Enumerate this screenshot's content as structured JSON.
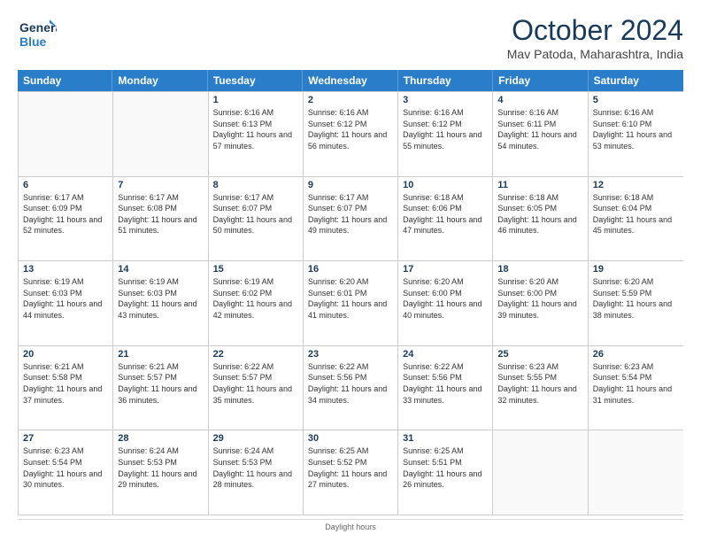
{
  "logo": {
    "line1": "General",
    "line2": "Blue"
  },
  "title": "October 2024",
  "location": "Mav Patoda, Maharashtra, India",
  "header_days": [
    "Sunday",
    "Monday",
    "Tuesday",
    "Wednesday",
    "Thursday",
    "Friday",
    "Saturday"
  ],
  "footer": "Daylight hours",
  "weeks": [
    [
      {
        "day": "",
        "sunrise": "",
        "sunset": "",
        "daylight": "",
        "empty": true
      },
      {
        "day": "",
        "sunrise": "",
        "sunset": "",
        "daylight": "",
        "empty": true
      },
      {
        "day": "1",
        "sunrise": "Sunrise: 6:16 AM",
        "sunset": "Sunset: 6:13 PM",
        "daylight": "Daylight: 11 hours and 57 minutes."
      },
      {
        "day": "2",
        "sunrise": "Sunrise: 6:16 AM",
        "sunset": "Sunset: 6:12 PM",
        "daylight": "Daylight: 11 hours and 56 minutes."
      },
      {
        "day": "3",
        "sunrise": "Sunrise: 6:16 AM",
        "sunset": "Sunset: 6:12 PM",
        "daylight": "Daylight: 11 hours and 55 minutes."
      },
      {
        "day": "4",
        "sunrise": "Sunrise: 6:16 AM",
        "sunset": "Sunset: 6:11 PM",
        "daylight": "Daylight: 11 hours and 54 minutes."
      },
      {
        "day": "5",
        "sunrise": "Sunrise: 6:16 AM",
        "sunset": "Sunset: 6:10 PM",
        "daylight": "Daylight: 11 hours and 53 minutes."
      }
    ],
    [
      {
        "day": "6",
        "sunrise": "Sunrise: 6:17 AM",
        "sunset": "Sunset: 6:09 PM",
        "daylight": "Daylight: 11 hours and 52 minutes.",
        "empty": false
      },
      {
        "day": "7",
        "sunrise": "Sunrise: 6:17 AM",
        "sunset": "Sunset: 6:08 PM",
        "daylight": "Daylight: 11 hours and 51 minutes.",
        "empty": false
      },
      {
        "day": "8",
        "sunrise": "Sunrise: 6:17 AM",
        "sunset": "Sunset: 6:07 PM",
        "daylight": "Daylight: 11 hours and 50 minutes.",
        "empty": false
      },
      {
        "day": "9",
        "sunrise": "Sunrise: 6:17 AM",
        "sunset": "Sunset: 6:07 PM",
        "daylight": "Daylight: 11 hours and 49 minutes.",
        "empty": false
      },
      {
        "day": "10",
        "sunrise": "Sunrise: 6:18 AM",
        "sunset": "Sunset: 6:06 PM",
        "daylight": "Daylight: 11 hours and 47 minutes.",
        "empty": false
      },
      {
        "day": "11",
        "sunrise": "Sunrise: 6:18 AM",
        "sunset": "Sunset: 6:05 PM",
        "daylight": "Daylight: 11 hours and 46 minutes.",
        "empty": false
      },
      {
        "day": "12",
        "sunrise": "Sunrise: 6:18 AM",
        "sunset": "Sunset: 6:04 PM",
        "daylight": "Daylight: 11 hours and 45 minutes.",
        "empty": false
      }
    ],
    [
      {
        "day": "13",
        "sunrise": "Sunrise: 6:19 AM",
        "sunset": "Sunset: 6:03 PM",
        "daylight": "Daylight: 11 hours and 44 minutes.",
        "empty": false
      },
      {
        "day": "14",
        "sunrise": "Sunrise: 6:19 AM",
        "sunset": "Sunset: 6:03 PM",
        "daylight": "Daylight: 11 hours and 43 minutes.",
        "empty": false
      },
      {
        "day": "15",
        "sunrise": "Sunrise: 6:19 AM",
        "sunset": "Sunset: 6:02 PM",
        "daylight": "Daylight: 11 hours and 42 minutes.",
        "empty": false
      },
      {
        "day": "16",
        "sunrise": "Sunrise: 6:20 AM",
        "sunset": "Sunset: 6:01 PM",
        "daylight": "Daylight: 11 hours and 41 minutes.",
        "empty": false
      },
      {
        "day": "17",
        "sunrise": "Sunrise: 6:20 AM",
        "sunset": "Sunset: 6:00 PM",
        "daylight": "Daylight: 11 hours and 40 minutes.",
        "empty": false
      },
      {
        "day": "18",
        "sunrise": "Sunrise: 6:20 AM",
        "sunset": "Sunset: 6:00 PM",
        "daylight": "Daylight: 11 hours and 39 minutes.",
        "empty": false
      },
      {
        "day": "19",
        "sunrise": "Sunrise: 6:20 AM",
        "sunset": "Sunset: 5:59 PM",
        "daylight": "Daylight: 11 hours and 38 minutes.",
        "empty": false
      }
    ],
    [
      {
        "day": "20",
        "sunrise": "Sunrise: 6:21 AM",
        "sunset": "Sunset: 5:58 PM",
        "daylight": "Daylight: 11 hours and 37 minutes.",
        "empty": false
      },
      {
        "day": "21",
        "sunrise": "Sunrise: 6:21 AM",
        "sunset": "Sunset: 5:57 PM",
        "daylight": "Daylight: 11 hours and 36 minutes.",
        "empty": false
      },
      {
        "day": "22",
        "sunrise": "Sunrise: 6:22 AM",
        "sunset": "Sunset: 5:57 PM",
        "daylight": "Daylight: 11 hours and 35 minutes.",
        "empty": false
      },
      {
        "day": "23",
        "sunrise": "Sunrise: 6:22 AM",
        "sunset": "Sunset: 5:56 PM",
        "daylight": "Daylight: 11 hours and 34 minutes.",
        "empty": false
      },
      {
        "day": "24",
        "sunrise": "Sunrise: 6:22 AM",
        "sunset": "Sunset: 5:56 PM",
        "daylight": "Daylight: 11 hours and 33 minutes.",
        "empty": false
      },
      {
        "day": "25",
        "sunrise": "Sunrise: 6:23 AM",
        "sunset": "Sunset: 5:55 PM",
        "daylight": "Daylight: 11 hours and 32 minutes.",
        "empty": false
      },
      {
        "day": "26",
        "sunrise": "Sunrise: 6:23 AM",
        "sunset": "Sunset: 5:54 PM",
        "daylight": "Daylight: 11 hours and 31 minutes.",
        "empty": false
      }
    ],
    [
      {
        "day": "27",
        "sunrise": "Sunrise: 6:23 AM",
        "sunset": "Sunset: 5:54 PM",
        "daylight": "Daylight: 11 hours and 30 minutes.",
        "empty": false
      },
      {
        "day": "28",
        "sunrise": "Sunrise: 6:24 AM",
        "sunset": "Sunset: 5:53 PM",
        "daylight": "Daylight: 11 hours and 29 minutes.",
        "empty": false
      },
      {
        "day": "29",
        "sunrise": "Sunrise: 6:24 AM",
        "sunset": "Sunset: 5:53 PM",
        "daylight": "Daylight: 11 hours and 28 minutes.",
        "empty": false
      },
      {
        "day": "30",
        "sunrise": "Sunrise: 6:25 AM",
        "sunset": "Sunset: 5:52 PM",
        "daylight": "Daylight: 11 hours and 27 minutes.",
        "empty": false
      },
      {
        "day": "31",
        "sunrise": "Sunrise: 6:25 AM",
        "sunset": "Sunset: 5:51 PM",
        "daylight": "Daylight: 11 hours and 26 minutes.",
        "empty": false
      },
      {
        "day": "",
        "sunrise": "",
        "sunset": "",
        "daylight": "",
        "empty": true
      },
      {
        "day": "",
        "sunrise": "",
        "sunset": "",
        "daylight": "",
        "empty": true
      }
    ]
  ]
}
